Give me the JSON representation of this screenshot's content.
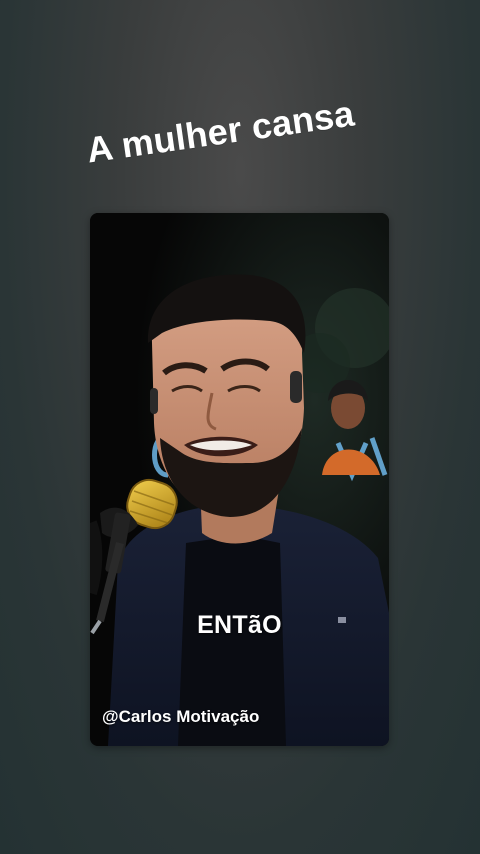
{
  "header": {
    "caption": "A mulher cansa"
  },
  "video": {
    "overlay_word": "ENTãO",
    "channel_handle": "@Carlos Motivação"
  },
  "colors": {
    "background_top": "#4a4a4a",
    "background_bottom": "#243233",
    "caption_text": "#ffffff",
    "microphone_gold": "#c9a227",
    "stage_light_blue": "#6fb7e8"
  }
}
